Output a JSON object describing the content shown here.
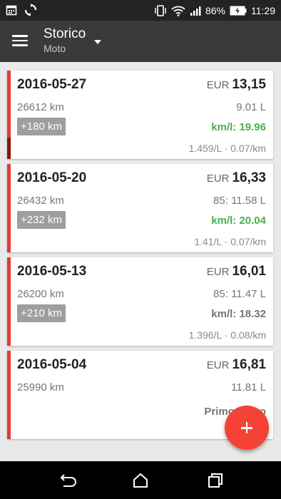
{
  "status_bar": {
    "battery": "86%",
    "time": "11:29",
    "icons": [
      "calendar-icon",
      "sync-icon",
      "vibrate-icon",
      "wifi-icon",
      "signal-icon",
      "battery-icon"
    ]
  },
  "toolbar": {
    "title": "Storico",
    "subtitle": "Moto",
    "menu_icon": "hamburger-menu-icon",
    "dropdown_icon": "dropdown-caret-icon"
  },
  "entries": [
    {
      "date": "2016-05-27",
      "currency": "EUR",
      "amount": "13,15",
      "odometer": "26612 km",
      "liters": "9.01 L",
      "delta_km": "+180 km",
      "efficiency": "km/l: 19.96",
      "efficiency_color": "#4caf50",
      "cost_info": "1.459/L · 0.07/km"
    },
    {
      "date": "2016-05-20",
      "currency": "EUR",
      "amount": "16,33",
      "odometer": "26432 km",
      "liters": "85: 11.58 L",
      "delta_km": "+232 km",
      "efficiency": "km/l: 20.04",
      "efficiency_color": "#4caf50",
      "cost_info": "1.41/L · 0.07/km"
    },
    {
      "date": "2016-05-13",
      "currency": "EUR",
      "amount": "16,01",
      "odometer": "26200 km",
      "liters": "85: 11.47 L",
      "delta_km": "+210 km",
      "efficiency": "km/l: 18.32",
      "efficiency_color": "#757575",
      "cost_info": "1.396/L · 0.08/km"
    },
    {
      "date": "2016-05-04",
      "currency": "EUR",
      "amount": "16,81",
      "odometer": "25990 km",
      "liters": "11.81 L",
      "note": "Primo pieno"
    }
  ],
  "fab": {
    "icon": "add-icon"
  },
  "nav": {
    "back_icon": "back-icon",
    "home_icon": "home-icon",
    "recents_icon": "recents-icon"
  },
  "colors": {
    "accent": "#f44336",
    "toolbar": "#3a3a3a",
    "card_stripe": "#e53935"
  }
}
